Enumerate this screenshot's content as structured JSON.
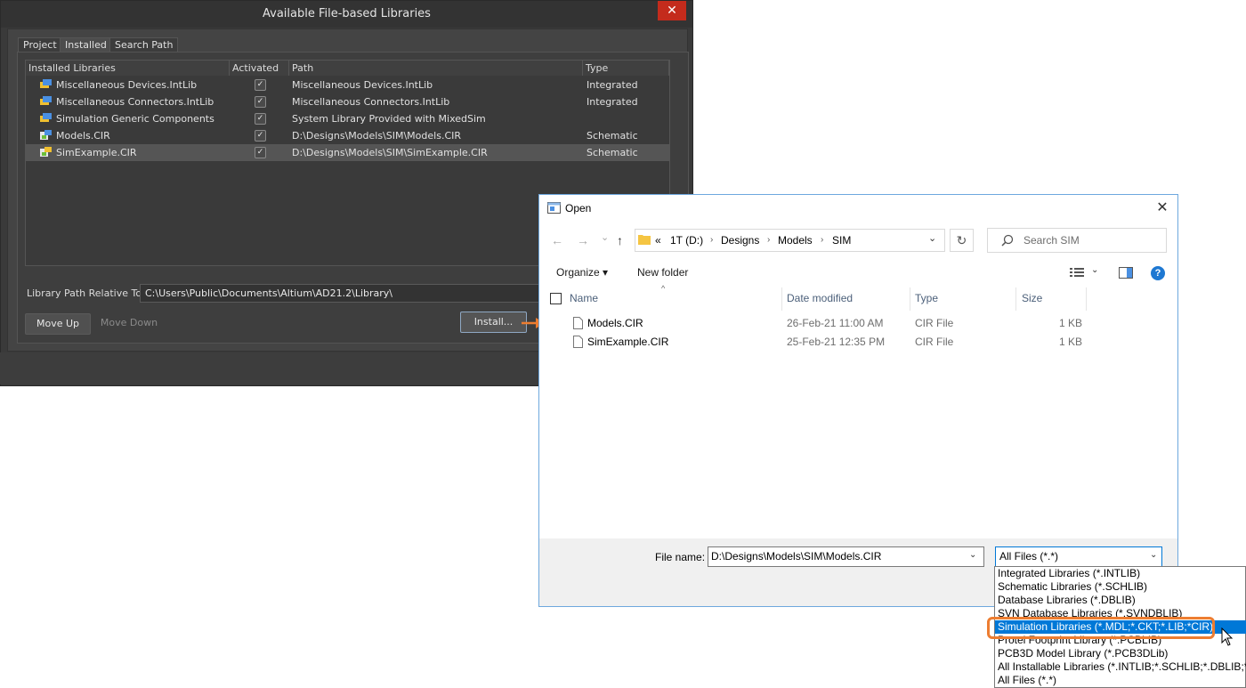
{
  "lib_dialog": {
    "title": "Available File-based Libraries",
    "close_glyph": "✕",
    "tabs": [
      "Project",
      "Installed",
      "Search Path"
    ],
    "active_tab": "Installed",
    "columns": [
      "Installed Libraries",
      "Activated",
      "Path",
      "Type"
    ],
    "rows": [
      {
        "name": "Miscellaneous Devices.IntLib",
        "activated": true,
        "path": "Miscellaneous Devices.IntLib",
        "type": "Integrated",
        "icon": "integrated-library-icon"
      },
      {
        "name": "Miscellaneous Connectors.IntLib",
        "activated": true,
        "path": "Miscellaneous Connectors.IntLib",
        "type": "Integrated",
        "icon": "integrated-library-icon"
      },
      {
        "name": "Simulation Generic Components",
        "activated": true,
        "path": "System Library Provided with MixedSim",
        "type": "",
        "icon": "integrated-library-icon"
      },
      {
        "name": "Models.CIR",
        "activated": true,
        "path": "D:\\Designs\\Models\\SIM\\Models.CIR",
        "type": "Schematic",
        "icon": "schematic-library-icon"
      },
      {
        "name": "SimExample.CIR",
        "activated": true,
        "path": "D:\\Designs\\Models\\SIM\\SimExample.CIR",
        "type": "Schematic",
        "icon": "schematic-library-icon",
        "selected": true
      }
    ],
    "check_glyph": "✓",
    "relative_label": "Library Path Relative To:",
    "relative_path": "C:\\Users\\Public\\Documents\\Altium\\AD21.2\\Library\\",
    "move_up": "Move Up",
    "move_down": "Move Down",
    "install": "Install..."
  },
  "open_dialog": {
    "title": "Open",
    "close_glyph": "✕",
    "nav": {
      "back": "←",
      "forward": "→",
      "recent": "⌄",
      "up": "↑"
    },
    "breadcrumb": [
      "«",
      "1T (D:)",
      "Designs",
      "Models",
      "SIM"
    ],
    "crumb_sep": "›",
    "refresh_glyph": "↻",
    "search_placeholder": "Search SIM",
    "organize": "Organize ▾",
    "new_folder": "New folder",
    "help": "?",
    "columns": [
      "Name",
      "Date modified",
      "Type",
      "Size"
    ],
    "files": [
      {
        "name": "Models.CIR",
        "date": "26-Feb-21 11:00 AM",
        "type": "CIR File",
        "size": "1 KB"
      },
      {
        "name": "SimExample.CIR",
        "date": "25-Feb-21 12:35 PM",
        "type": "CIR File",
        "size": "1 KB"
      }
    ],
    "file_name_label": "File name:",
    "file_name_value": "D:\\Designs\\Models\\SIM\\Models.CIR",
    "file_type_value": "All Files (*.*)",
    "dropdown_glyph": "⌄",
    "file_type_options": [
      "Integrated Libraries (*.INTLIB)",
      "Schematic Libraries (*.SCHLIB)",
      "Database Libraries (*.DBLIB)",
      "SVN Database Libraries (*.SVNDBLIB)",
      "Simulation Libraries (*.MDL;*.CKT;*.LIB;*CIR)",
      "Protel Footprint Library (*.PCBLIB)",
      "PCB3D Model Library (*.PCB3DLib)",
      "All Installable Libraries (*.INTLIB;*.SCHLIB;*.DBLIB;*.SVNDBLIB;*.PCBLIB)",
      "All Files (*.*)"
    ],
    "highlighted_option": "Simulation Libraries (*.MDL;*.CKT;*.LIB;*CIR)"
  },
  "colors": {
    "accent_orange": "#ed7d31",
    "selection_blue": "#0078d7",
    "dark_bg": "#3a3a3a"
  }
}
